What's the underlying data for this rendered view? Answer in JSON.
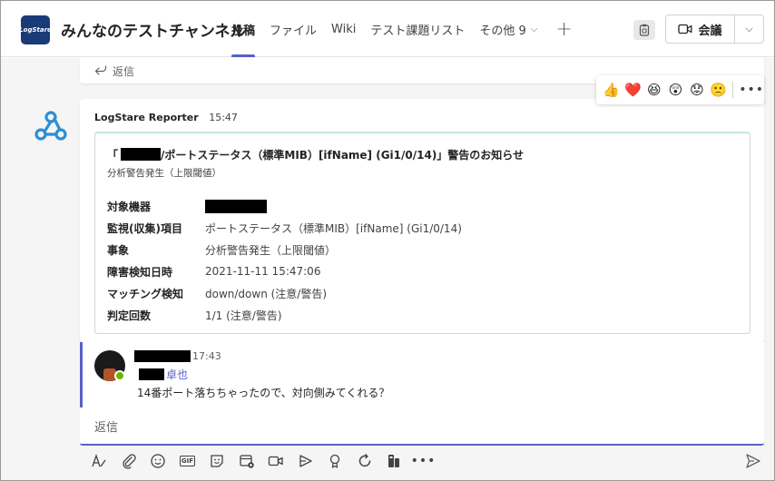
{
  "header": {
    "logo_text": "LogStare",
    "channel_title": "みんなのテストチャンネル",
    "tabs": [
      {
        "label": "投稿"
      },
      {
        "label": "ファイル"
      },
      {
        "label": "Wiki"
      },
      {
        "label": "テスト課題リスト"
      },
      {
        "label": "その他 9"
      }
    ],
    "meet_label": "会議"
  },
  "chat": {
    "reply_top_label": "返信",
    "reactions": [
      "👍",
      "❤️",
      "😆",
      "😲",
      "😟",
      "🙁"
    ],
    "message": {
      "sender": "LogStare Reporter",
      "time": "15:47",
      "card": {
        "title_prefix": "「",
        "title_rest": "/ポートステータス（標準MIB）[ifName] (Gi1/0/14)」警告のお知らせ",
        "subtitle": "分析警告発生（上限閾値）",
        "facts": [
          {
            "key": "対象機器",
            "value": ""
          },
          {
            "key": "監視(収集)項目",
            "value": "ポートステータス（標準MIB）[ifName] (Gi1/0/14)"
          },
          {
            "key": "事象",
            "value": "分析警告発生（上限閾値）"
          },
          {
            "key": "障害検知日時",
            "value": "2021-11-11 15:47:06"
          },
          {
            "key": "マッチング検知",
            "value": "down/down (注意/警告)"
          },
          {
            "key": "判定回数",
            "value": "1/1 (注意/警告)"
          }
        ]
      }
    },
    "reply": {
      "time": "17:43",
      "mention": "卓也",
      "text": "14番ポート落ちちゃったので、対向側みてくれる？"
    },
    "composer_placeholder": "返信"
  },
  "colors": {
    "accent": "#5b5fc7",
    "presence": "#6bb700"
  }
}
